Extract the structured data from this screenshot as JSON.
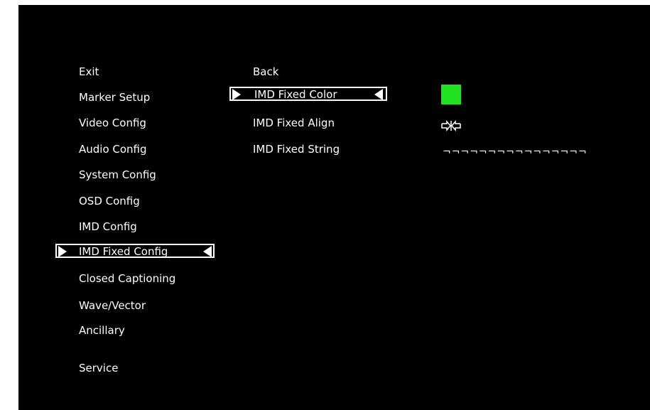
{
  "menu": {
    "items": [
      "Exit",
      "Marker Setup",
      "Video Config",
      "Audio Config",
      "System Config",
      "OSD Config",
      "IMD Config",
      "IMD Fixed Config",
      "Closed Captioning",
      "Wave/Vector",
      "Ancillary",
      "Service"
    ],
    "selected": "IMD Fixed Config"
  },
  "submenu": {
    "back": "Back",
    "items": [
      "IMD Fixed Color",
      "IMD Fixed Align",
      "IMD Fixed String"
    ],
    "selected": "IMD Fixed Color"
  },
  "values": {
    "color_swatch": "#22e022",
    "align_icon": "center-align-icon",
    "string": "¬¬¬¬¬¬¬¬¬¬¬¬¬¬¬¬"
  },
  "colors": {
    "background": "#000000",
    "text": "#ffffff",
    "selection_border": "#ffffff"
  }
}
